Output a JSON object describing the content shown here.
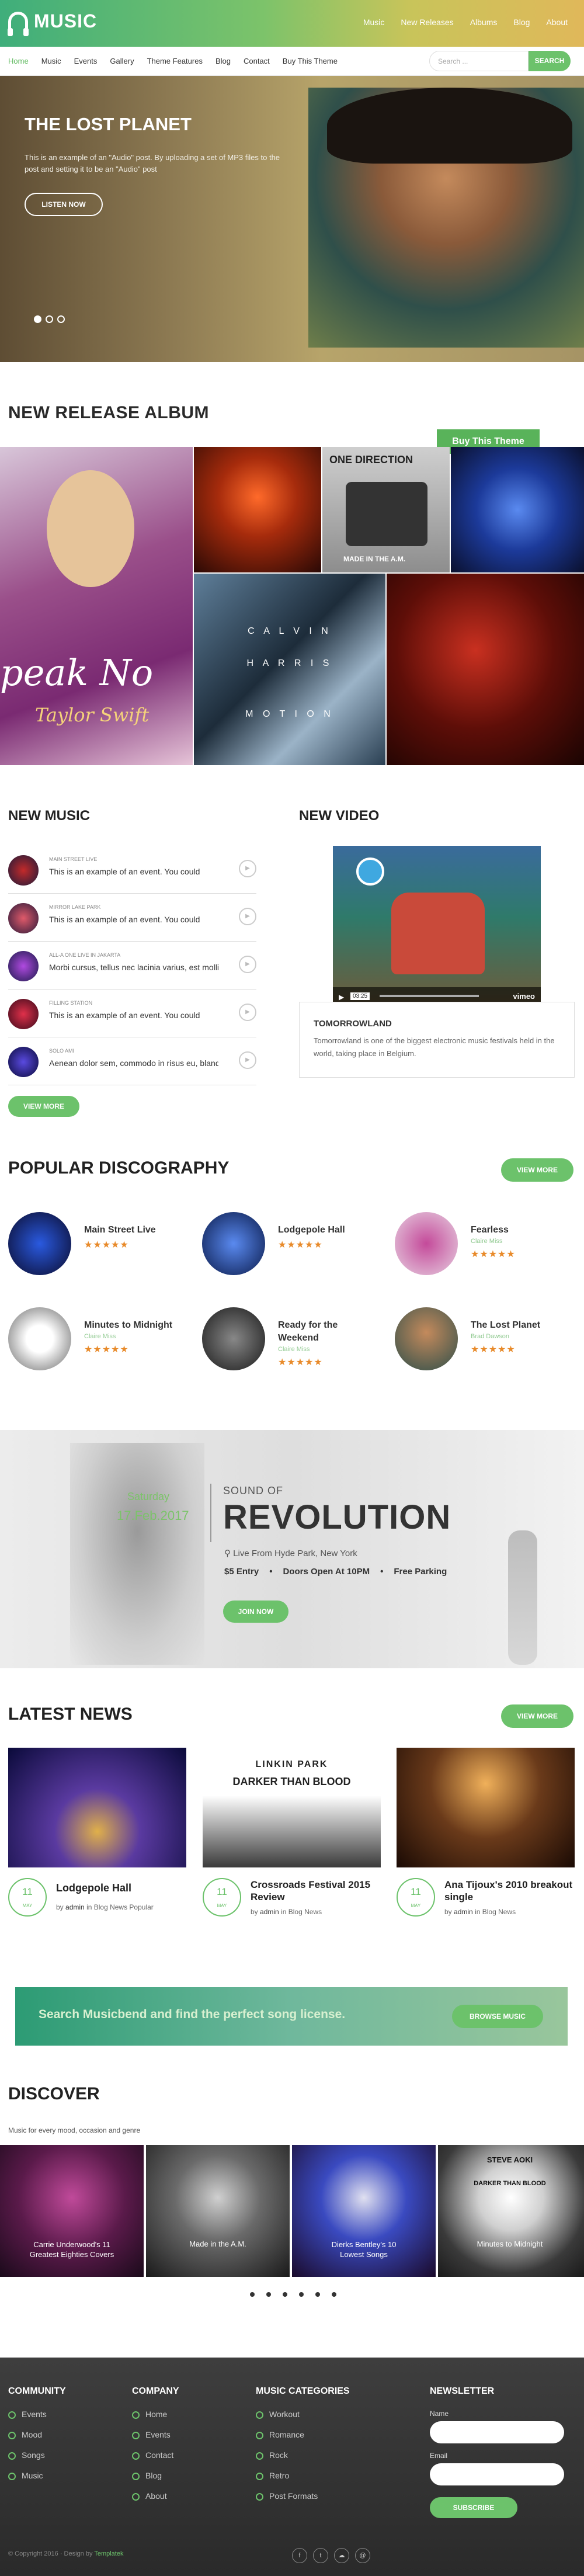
{
  "header": {
    "brand": "MUSIC",
    "nav": [
      "Music",
      "New Releases",
      "Albums",
      "Blog",
      "About"
    ]
  },
  "subnav": {
    "items": [
      "Home",
      "Music",
      "Events",
      "Gallery",
      "Theme Features",
      "Blog",
      "Contact",
      "Buy This Theme"
    ],
    "search_placeholder": "Search ...",
    "search_button": "SEARCH"
  },
  "hero": {
    "title": "THE LOST PLANET",
    "text": "This is an example of an \"Audio\" post. By uploading a set of MP3 files to the post and setting it to be an \"Audio\" post",
    "button": "LISTEN NOW"
  },
  "albums": {
    "title": "NEW RELEASE ALBUM",
    "buy": "Buy This Theme",
    "album_text_1": "peak No",
    "album_text_2": "Taylor Swift",
    "calvin": [
      "C A L V I N",
      "H A R R I S",
      "M O T I O N"
    ],
    "onedirection": "ONE DIRECTION",
    "made": "MADE IN THE A.M."
  },
  "new_music": {
    "title": "NEW MUSIC",
    "items": [
      {
        "label": "MAIN STREET LIVE",
        "text": "This is an example of an event. You could"
      },
      {
        "label": "MIRROR LAKE PARK",
        "text": "This is an example of an event. You could"
      },
      {
        "label": "ALL-A ONE LIVE IN JAKARTA",
        "text": "Morbi cursus, tellus nec lacinia varius, est mollis..."
      },
      {
        "label": "FILLING STATION",
        "text": "This is an example of an event. You could"
      },
      {
        "label": "SOLO AMI",
        "text": "Aenean dolor sem, commodo in risus eu, blandi..."
      }
    ],
    "more": "VIEW MORE"
  },
  "new_video": {
    "title": "NEW VIDEO",
    "time": "03:25",
    "vimeo": "vimeo",
    "card_title": "TOMORROWLAND",
    "card_text": "Tomorrowland is one of the biggest electronic music festivals held in the world, taking place in Belgium."
  },
  "discography": {
    "title": "POPULAR DISCOGRAPHY",
    "more": "VIEW MORE",
    "items": [
      {
        "name": "Main Street Live",
        "artist": "",
        "stars": "★★★★★"
      },
      {
        "name": "Lodgepole Hall",
        "artist": "",
        "stars": "★★★★★"
      },
      {
        "name": "Fearless",
        "artist": "Claire Miss",
        "stars": "★★★★★"
      },
      {
        "name": "Minutes to Midnight",
        "artist": "Claire Miss",
        "stars": "★★★★★"
      },
      {
        "name": "Ready for the Weekend",
        "artist": "Claire Miss",
        "stars": "★★★★★"
      },
      {
        "name": "The Lost Planet",
        "artist": "Brad Dawson",
        "stars": "★★★★★"
      }
    ]
  },
  "concert": {
    "day": "Saturday",
    "date": "17.Feb.2017",
    "sound": "SOUND OF",
    "title": "REVOLUTION",
    "place": "Live From Hyde Park, New York",
    "entry": "$5 Entry",
    "doors": "Doors Open At 10PM",
    "parking": "Free Parking",
    "join": "JOIN NOW"
  },
  "news": {
    "title": "LATEST NEWS",
    "more": "VIEW MORE",
    "items": [
      {
        "day": "11",
        "month": "MAY",
        "title": "Lodgepole Hall",
        "by": "by",
        "author": "admin",
        "cat": "in Blog News Popular"
      },
      {
        "day": "11",
        "month": "MAY",
        "title": "Crossroads Festival 2015 Review",
        "by": "by",
        "author": "admin",
        "cat": "in Blog News"
      },
      {
        "day": "11",
        "month": "MAY",
        "title": "Ana Tijoux's 2010 breakout single",
        "by": "by",
        "author": "admin",
        "cat": "in Blog News"
      }
    ],
    "linkin_1": "LINKIN PARK",
    "linkin_2": "DARKER THAN BLOOD"
  },
  "banner": {
    "text": "Search Musicbend and find the perfect song license.",
    "button": "BROWSE MUSIC"
  },
  "discover": {
    "title": "DISCOVER",
    "sub": "Music for every mood, occasion and genre",
    "items": [
      "Carrie Underwood's 11 Greatest Eighties Covers",
      "Made in the A.M.",
      "Dierks Bentley's 10 Lowest Songs",
      "Minutes to Midnight"
    ],
    "steve": "STEVE AOKI",
    "darker": "DARKER THAN BLOOD"
  },
  "footer": {
    "community": {
      "title": "COMMUNITY",
      "items": [
        "Events",
        "Mood",
        "Songs",
        "Music"
      ]
    },
    "company": {
      "title": "COMPANY",
      "items": [
        "Home",
        "Events",
        "Contact",
        "Blog",
        "About"
      ]
    },
    "categories": {
      "title": "MUSIC CATEGORIES",
      "items": [
        "Workout",
        "Romance",
        "Rock",
        "Retro",
        "Post Formats"
      ]
    },
    "newsletter": {
      "title": "NEWSLETTER",
      "name": "Name",
      "email": "Email",
      "button": "SUBSCRIBE"
    },
    "copyright": "© Copyright 2016 · Design by",
    "copyright_link": "Templatek",
    "social": [
      "f",
      "t",
      "☁",
      "@"
    ]
  },
  "colors": {
    "accent": "#6cc26b",
    "star": "#e88a2a"
  }
}
